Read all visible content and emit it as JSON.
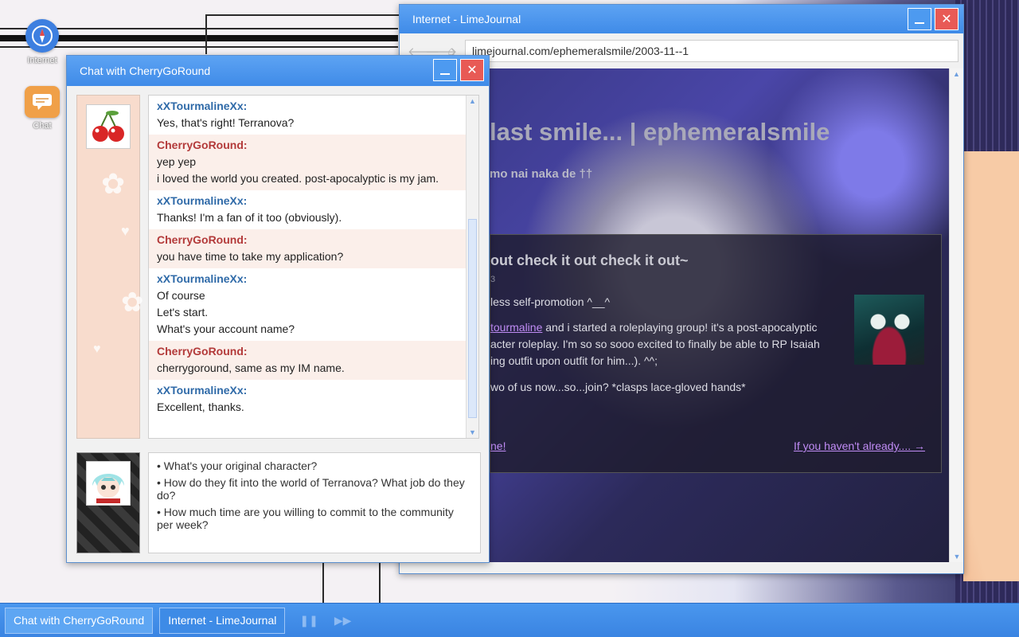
{
  "desktop": {
    "icons": [
      {
        "label": "Internet"
      },
      {
        "label": "Chat"
      }
    ]
  },
  "browser": {
    "title": "Internet - LimeJournal",
    "url": "limejournal.com/ephemeralsmile/2003-11--1",
    "blog_title": "last smile... | ephemeralsmile",
    "blog_subtitle": "mo nai naka de ††",
    "post": {
      "title": "out check it out check it out~",
      "date": "3",
      "line1": "less self-promotion ^__^",
      "link_user": "tourmaline",
      "line2_rest": " and i started a roleplaying group! it's a post-apocalyptic",
      "line3": "acter roleplay. I'm so so sooo excited to finally be able to RP Isaiah",
      "line4": "ing outfit upon outfit for him...). ^^;",
      "line5": "wo of us now...so...join? *clasps lace-gloved hands*",
      "footer_left": "ne!",
      "footer_right": "If you haven't already.... →"
    }
  },
  "chat": {
    "title": "Chat with CherryGoRound",
    "messages": [
      {
        "sender": "xXTourmalineXx:",
        "lines": [
          "Yes, that's right! Terranova?"
        ]
      },
      {
        "sender": "CherryGoRound:",
        "lines": [
          "yep yep",
          "i loved the world you created. post-apocalyptic is my jam."
        ]
      },
      {
        "sender": "xXTourmalineXx:",
        "lines": [
          "Thanks! I'm a fan of it too (obviously)."
        ]
      },
      {
        "sender": "CherryGoRound:",
        "lines": [
          "you have time to take my application?"
        ]
      },
      {
        "sender": "xXTourmalineXx:",
        "lines": [
          "Of course",
          "Let's start.",
          "What's your account name?"
        ]
      },
      {
        "sender": "CherryGoRound:",
        "lines": [
          "cherrygoround, same as my IM name."
        ]
      },
      {
        "sender": "xXTourmalineXx:",
        "lines": [
          "Excellent, thanks."
        ]
      }
    ],
    "input_lines": [
      "• What's your original character?",
      "• How do they fit into the world of Terranova? What job do they do?",
      "• How much time are you willing to commit to the community per week?"
    ]
  },
  "taskbar": {
    "items": [
      {
        "label": "Chat with CherryGoRound"
      },
      {
        "label": "Internet - LimeJournal"
      }
    ]
  },
  "colors": {
    "titlebar": "#4a97ee",
    "close": "#e85a55",
    "xx_name": "#2f6aa8",
    "cherry_name": "#b33a3a",
    "link": "#c08cf5"
  }
}
